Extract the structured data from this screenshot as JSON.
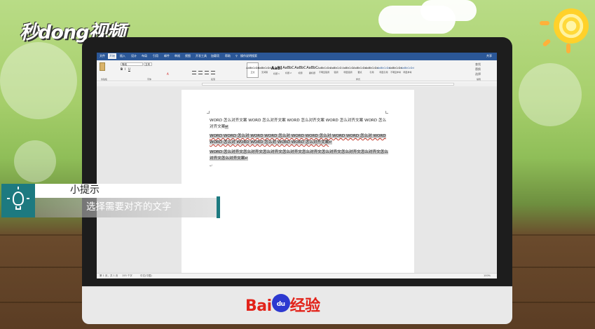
{
  "brand": {
    "site_logo": "秒dong视频",
    "footer_brand": "Bai",
    "footer_paw": "du",
    "footer_suffix": "经验"
  },
  "word": {
    "menu": [
      "文件",
      "开始",
      "插入",
      "设计",
      "布局",
      "引用",
      "邮件",
      "审阅",
      "视图",
      "开发工具",
      "加载项",
      "帮助",
      "操作说明搜索",
      "共享"
    ],
    "active_menu": "开始",
    "clipboard_label": "剪贴板",
    "font_label": "字体",
    "paragraph_label": "段落",
    "styles_label": "样式",
    "font_name": "等线",
    "font_size": "五号",
    "styles": [
      {
        "preview": "AaBbCcDd",
        "name": "正文",
        "kind": "normal"
      },
      {
        "preview": "AaBbCcDd",
        "name": "无间隔",
        "kind": "normal"
      },
      {
        "preview": "AaBl",
        "name": "标题 1",
        "kind": "big"
      },
      {
        "preview": "AaBbC",
        "name": "标题 2",
        "kind": "mid"
      },
      {
        "preview": "AaBbC",
        "name": "标题",
        "kind": "mid"
      },
      {
        "preview": "AaBbC",
        "name": "副标题",
        "kind": "mid"
      },
      {
        "preview": "AaBbCcDd",
        "name": "不明显强调",
        "kind": "normal"
      },
      {
        "preview": "AaBbCcD",
        "name": "强调",
        "kind": "normal"
      },
      {
        "preview": "AaBbCcD",
        "name": "明显强调",
        "kind": "normal"
      },
      {
        "preview": "AaBbCcDd",
        "name": "要点",
        "kind": "normal"
      },
      {
        "preview": "AaBbCcDd",
        "name": "引用",
        "kind": "normal"
      },
      {
        "preview": "AaBbCcDd",
        "name": "明显引用",
        "kind": "blue"
      },
      {
        "preview": "AaBbCcDd",
        "name": "不明显参考",
        "kind": "normal"
      },
      {
        "preview": "AaBbCcDd",
        "name": "明显参考",
        "kind": "blue"
      }
    ],
    "edit_actions": [
      "查找",
      "替换",
      "选择"
    ],
    "edit_label": "编辑",
    "document": {
      "para1": "WORD 怎么对齐文案 WORD 怎么对齐文案 WORD 怎么对齐文案 WORD 怎么对齐文案 WORD 怎么对齐文案",
      "para2": "WORD WORD 怎么对 WORD WORD 怎么对 WORD WORD 怎么对 WORD WORD 怎么对 WORD WORD 怎么对 WORD WORD 怎么对 WORD WORD 怎么对齐文案",
      "para3": "WORD 怎么对齐文怎么对齐文怎么对齐文怎么对齐文怎么对齐文怎么对齐文怎么对齐文怎么对齐文怎么对齐文怎么对齐文案"
    },
    "status": {
      "page": "第 1 页，共 1 页",
      "words": "155 个字",
      "lang": "中文(中国)",
      "zoom": "100%"
    }
  },
  "tip": {
    "title": "小提示",
    "text": "选择需要对齐的文字"
  },
  "colors": {
    "menubar": "#2b5797",
    "tip_accent": "#1d7a80",
    "baidu_red": "#e2231a",
    "baidu_blue": "#2d39d0"
  }
}
